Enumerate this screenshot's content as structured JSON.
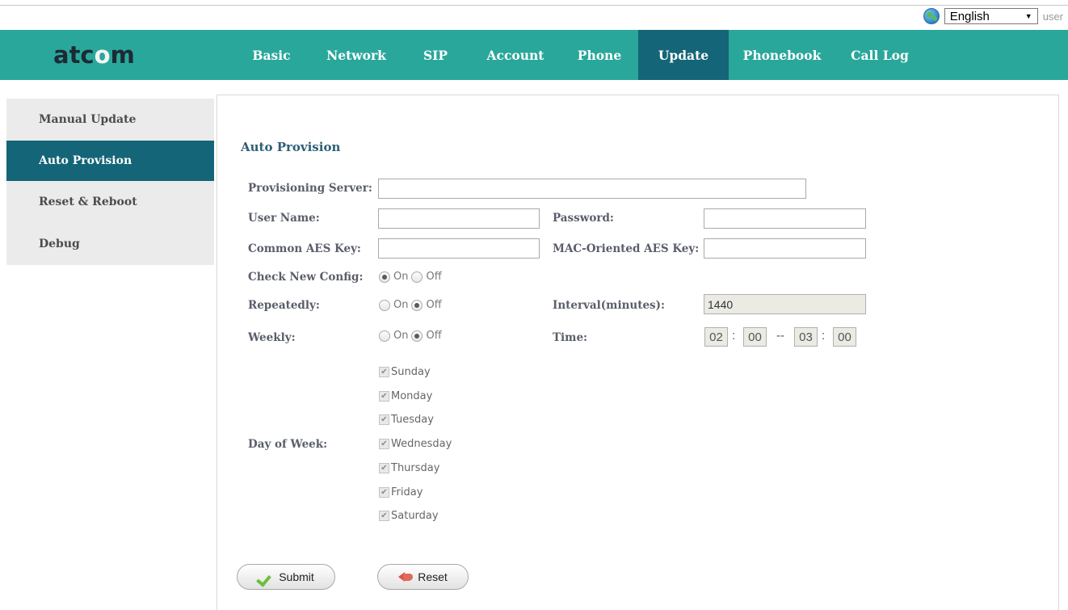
{
  "top": {
    "language": "English",
    "user_label": "user"
  },
  "brand": {
    "logo_prefix": "atc",
    "logo_o": "o",
    "logo_suffix": "m"
  },
  "nav": {
    "items": [
      {
        "label": "Basic"
      },
      {
        "label": "Network"
      },
      {
        "label": "SIP"
      },
      {
        "label": "Account"
      },
      {
        "label": "Phone"
      },
      {
        "label": "Update",
        "active": true
      },
      {
        "label": "Phonebook"
      },
      {
        "label": "Call Log"
      }
    ]
  },
  "sidebar": {
    "items": [
      {
        "label": "Manual Update"
      },
      {
        "label": "Auto Provision",
        "active": true
      },
      {
        "label": "Reset & Reboot"
      },
      {
        "label": "Debug"
      }
    ]
  },
  "form": {
    "title": "Auto Provision",
    "provisioning_server": {
      "label": "Provisioning Server:",
      "value": ""
    },
    "user_name": {
      "label": "User Name:",
      "value": ""
    },
    "password": {
      "label": "Password:",
      "value": ""
    },
    "common_aes_key": {
      "label": "Common AES Key:",
      "value": ""
    },
    "mac_aes_key": {
      "label": "MAC-Oriented AES Key:",
      "value": ""
    },
    "check_new_config": {
      "label": "Check New Config:",
      "on_label": "On",
      "off_label": "Off",
      "selected": "On"
    },
    "repeatedly": {
      "label": "Repeatedly:",
      "on_label": "On",
      "off_label": "Off",
      "selected": "Off"
    },
    "interval": {
      "label": "Interval(minutes):",
      "value": "1440"
    },
    "weekly": {
      "label": "Weekly:",
      "on_label": "On",
      "off_label": "Off",
      "selected": "Off"
    },
    "time": {
      "label": "Time:",
      "start_hour": "02",
      "start_min": "00",
      "end_hour": "03",
      "end_min": "00",
      "colon": ":",
      "dash": "--"
    },
    "day_of_week": {
      "label": "Day of Week:",
      "days": [
        "Sunday",
        "Monday",
        "Tuesday",
        "Wednesday",
        "Thursday",
        "Friday",
        "Saturday"
      ]
    },
    "submit_label": "Submit",
    "reset_label": "Reset"
  },
  "colors": {
    "header": "#2aa79b",
    "active_nav": "#146577",
    "sidebar_bg": "#ebebeb"
  }
}
